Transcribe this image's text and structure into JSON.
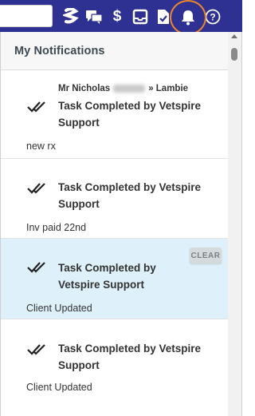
{
  "topbar": {
    "icons": [
      "logo-icon",
      "chat-icon",
      "dollar-icon",
      "inbox-icon",
      "task-icon",
      "bell-icon",
      "help-icon"
    ],
    "bg_color": "#2e3192",
    "highlight_color": "#e8862a"
  },
  "panel": {
    "title": "My Notifications"
  },
  "notifications": [
    {
      "from_first": "Mr Nicholas",
      "from_last": "» Lambie",
      "title": "Task Completed by Vetspire Support",
      "note": "new rx"
    },
    {
      "title": "Task Completed by Vetspire Support",
      "note": "Inv paid 22nd"
    },
    {
      "title": "Task Completed by Vetspire Support",
      "note": "Client Updated",
      "clear_label": "CLEAR"
    },
    {
      "title": "Task Completed by Vetspire Support",
      "note": "Client Updated"
    }
  ]
}
